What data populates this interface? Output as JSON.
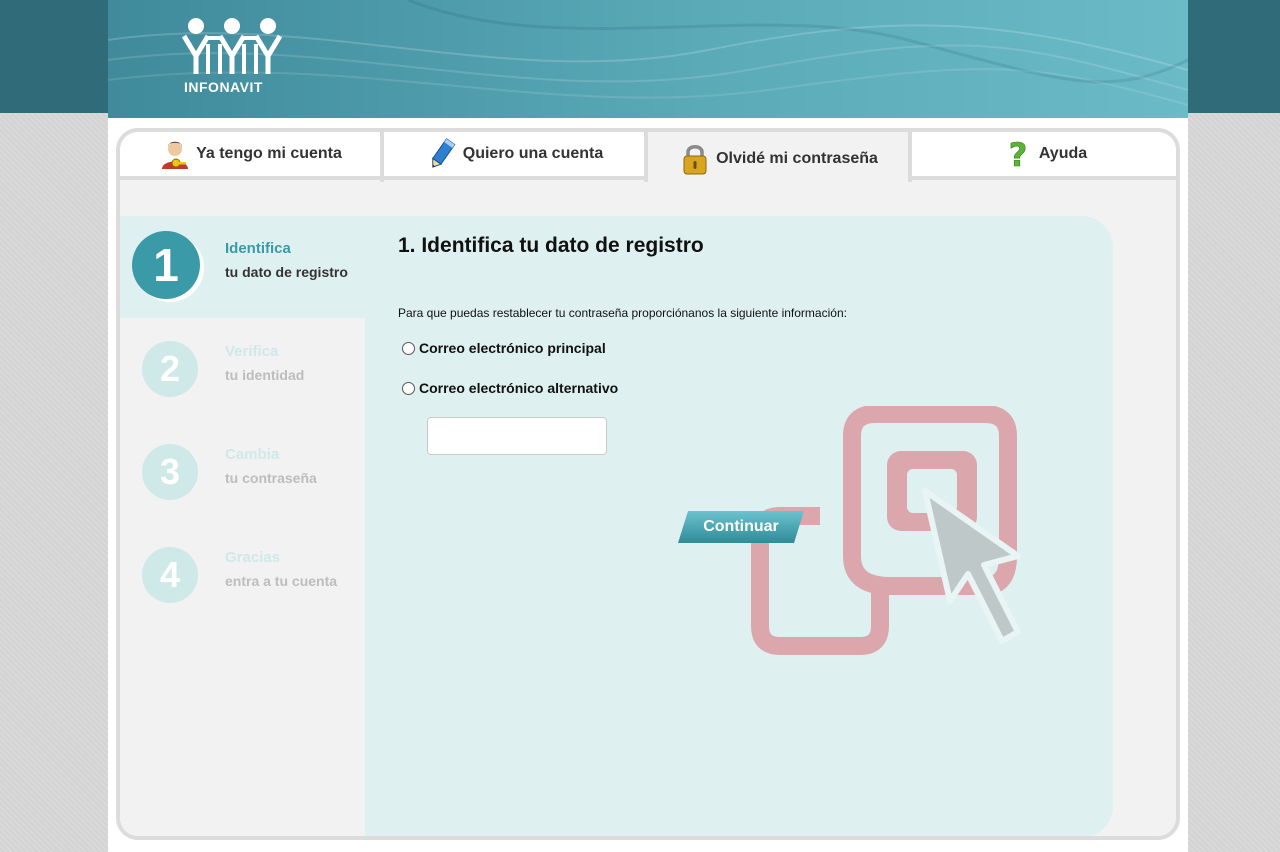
{
  "brand": {
    "name": "INFONAVIT"
  },
  "tabs": [
    {
      "label": "Ya tengo mi cuenta",
      "icon": "user-key-icon"
    },
    {
      "label": "Quiero una cuenta",
      "icon": "pencil-icon"
    },
    {
      "label": "Olvidé mi contraseña",
      "icon": "padlock-icon",
      "active": true
    },
    {
      "label": "Ayuda",
      "icon": "question-mark-icon"
    }
  ],
  "steps": [
    {
      "number": "1",
      "title": "Identifica",
      "subtitle": "tu dato de registro",
      "active": true
    },
    {
      "number": "2",
      "title": "Verifica",
      "subtitle": "tu identidad"
    },
    {
      "number": "3",
      "title": "Cambia",
      "subtitle": "tu contraseña"
    },
    {
      "number": "4",
      "title": "Gracias",
      "subtitle": "entra a tu cuenta"
    }
  ],
  "form": {
    "title": "1. Identifica tu dato de registro",
    "intro": "Para que puedas restablecer tu contraseña proporciónanos la siguiente información:",
    "options": [
      "Correo electrónico principal",
      "Correo electrónico alternativo"
    ],
    "input_value": "",
    "submit_label": "Continuar"
  },
  "colors": {
    "accent": "#3b9aa8",
    "step_inactive": "#cfe8e8",
    "panel": "#dff0f0",
    "header_band": "#2f6b78"
  }
}
